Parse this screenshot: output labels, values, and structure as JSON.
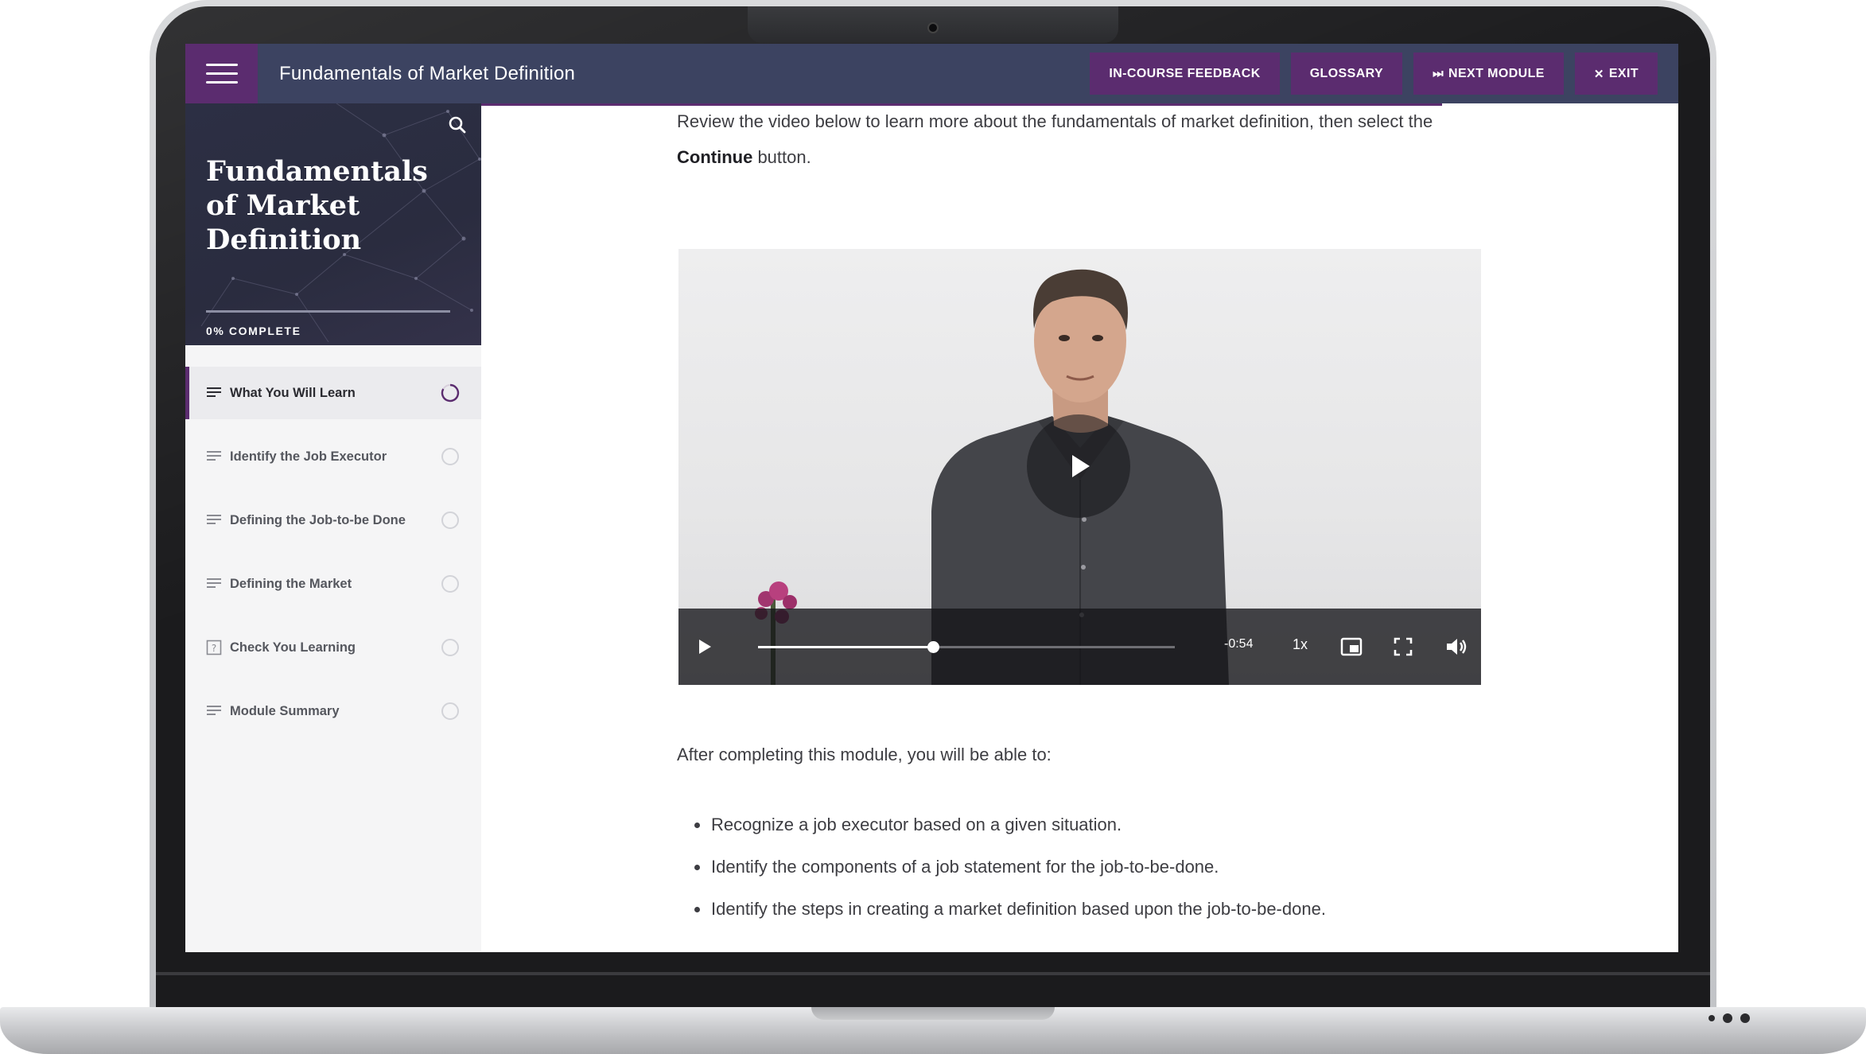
{
  "header": {
    "title": "Fundamentals of Market Definition",
    "buttons": {
      "feedback": "IN-COURSE FEEDBACK",
      "glossary": "GLOSSARY",
      "next_module": "NEXT MODULE",
      "exit": "EXIT"
    }
  },
  "sidebar": {
    "course_title": "Fundamentals of Market Definition",
    "progress_text": "0% COMPLETE",
    "progress_fraction": 0,
    "lessons": [
      {
        "label": "What You Will Learn",
        "icon": "text-lines-icon",
        "status": "in-progress"
      },
      {
        "label": "Identify the Job Executor",
        "icon": "text-lines-icon",
        "status": "not-started"
      },
      {
        "label": "Defining the Job-to-be Done",
        "icon": "text-lines-icon",
        "status": "not-started"
      },
      {
        "label": "Defining the Market",
        "icon": "text-lines-icon",
        "status": "not-started"
      },
      {
        "label": "Check You Learning",
        "icon": "question-box-icon",
        "status": "not-started"
      },
      {
        "label": "Module Summary",
        "icon": "text-lines-icon",
        "status": "not-started"
      }
    ]
  },
  "content": {
    "intro_before": "Review the video below to learn more about the fundamentals of market definition, then select the ",
    "intro_bold": "Continue",
    "intro_after": " button.",
    "after_video": "After completing this module, you will be able to:",
    "objectives": [
      "Recognize a job executor based on a given situation.",
      "Identify the components of a job statement for the job-to-be-done.",
      "Identify the steps in creating a market definition based upon the job-to-be-done."
    ]
  },
  "video": {
    "time_remaining": "-0:54",
    "speed": "1x",
    "played_fraction": 0.42
  },
  "colors": {
    "accent": "#5b2c6f",
    "header_bg": "#3c4361",
    "sidebar_bg": "#f5f5f6"
  }
}
